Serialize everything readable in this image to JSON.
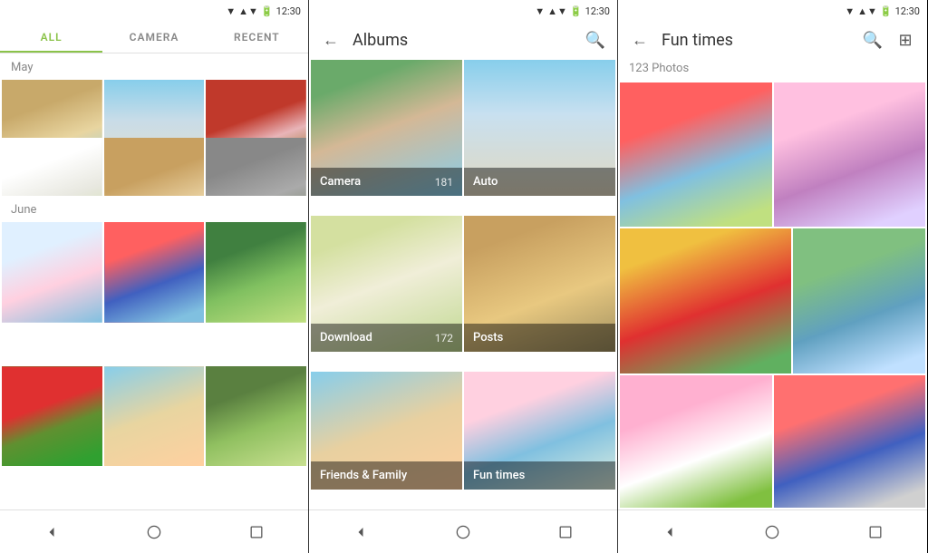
{
  "panel1": {
    "status_time": "12:30",
    "tabs": [
      "ALL",
      "CAMERA",
      "RECENT"
    ],
    "active_tab": "ALL",
    "sections": [
      {
        "label": "May",
        "photos": [
          "beach1",
          "beach2",
          "portrait1",
          "flowers1",
          "dog1",
          "street1"
        ]
      },
      {
        "label": "June",
        "photos": [
          "ribbon1",
          "kid1",
          "nature1",
          "tomatoes1",
          "beach4",
          "nature1"
        ]
      }
    ],
    "nav": [
      "back",
      "home",
      "square"
    ]
  },
  "panel2": {
    "status_time": "12:30",
    "title": "Albums",
    "albums": [
      {
        "name": "Camera",
        "count": "181",
        "color": "beach3"
      },
      {
        "name": "Auto",
        "count": "",
        "color": "auto1"
      },
      {
        "name": "Download",
        "count": "172",
        "color": "flowers1"
      },
      {
        "name": "Posts",
        "count": "",
        "color": "posts1"
      },
      {
        "name": "Friends & Family",
        "count": "",
        "color": "beach4"
      },
      {
        "name": "Fun times",
        "count": "",
        "color": "ribbon2"
      }
    ],
    "nav": [
      "back",
      "home",
      "square"
    ]
  },
  "panel3": {
    "status_time": "12:30",
    "title": "Fun times",
    "photos_count": "123 Photos",
    "nav": [
      "back",
      "home",
      "square"
    ]
  }
}
